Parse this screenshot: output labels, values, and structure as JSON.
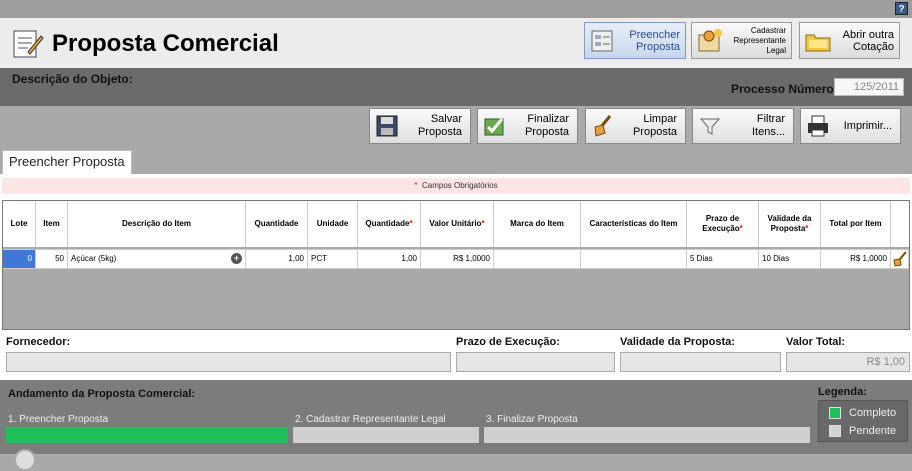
{
  "help": {
    "label": "?"
  },
  "header": {
    "title": "Proposta Comercial",
    "buttons": [
      {
        "label": "Preencher Proposta",
        "icon": "form-icon"
      },
      {
        "label": "Cadastrar Representante Legal",
        "icon": "person-icon"
      },
      {
        "label": "Abrir outra Cotação",
        "icon": "folder-icon"
      }
    ]
  },
  "desc": {
    "label": "Descrição do Objeto:",
    "processo_label": "Processo Número:",
    "processo_value": "125/2011"
  },
  "toolbar": {
    "salvar": "Salvar Proposta",
    "finalizar": "Finalizar Proposta",
    "limpar": "Limpar Proposta",
    "filtrar": "Filtrar Itens...",
    "imprimir": "Imprimir..."
  },
  "tab": {
    "label": "Preencher Proposta"
  },
  "required_note": {
    "star": "*",
    "text": "Campos Obrigatórios"
  },
  "grid": {
    "columns": [
      "Lote",
      "Item",
      "Descrição do Item",
      "Quantidade",
      "Unidade",
      "Quantidade",
      "Valor Unitário",
      "Marca do Item",
      "Características do Item",
      "Prazo de Execução",
      "Validade da Proposta",
      "Total por Item"
    ],
    "row": {
      "lote": "0",
      "item": "50",
      "descricao": "Açúcar (5kg)",
      "quantidade": "1,00",
      "unidade": "PCT",
      "quantidade2": "1,00",
      "valor_unitario": "R$ 1,0000",
      "marca": "",
      "caracteristicas": "",
      "prazo": "5 Dias",
      "validade": "10 Dias",
      "total": "R$ 1,0000"
    }
  },
  "summary": {
    "fornecedor_label": "Fornecedor:",
    "prazo_label": "Prazo de Execução:",
    "validade_label": "Validade da Proposta:",
    "valor_label": "Valor Total:",
    "valor_value": "R$ 1,00"
  },
  "progress": {
    "title": "Andamento da Proposta Comercial:",
    "steps": [
      {
        "label": "1. Preencher Proposta",
        "status": "Completo"
      },
      {
        "label": "2. Cadastrar Representante Legal",
        "status": "Pendente"
      },
      {
        "label": "3. Finalizar Proposta",
        "status": "Pendente"
      }
    ]
  },
  "legend": {
    "title": "Legenda:",
    "items": [
      {
        "label": "Completo",
        "color": "#1fc05a"
      },
      {
        "label": "Pendente",
        "color": "#d3d3d3"
      }
    ]
  },
  "colors": {
    "complete": "#1fc05a",
    "pending": "#cfcfcf",
    "accent": "#3f78d6"
  }
}
